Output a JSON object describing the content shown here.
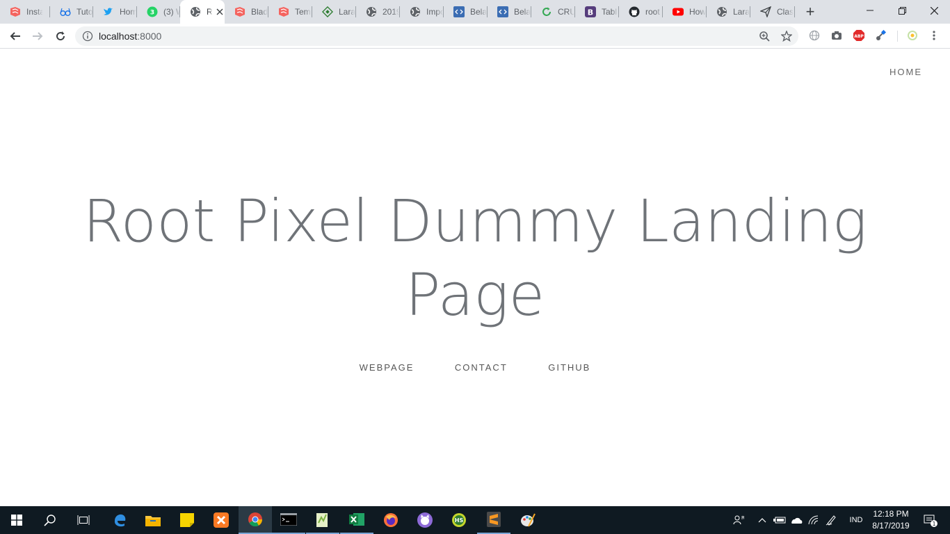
{
  "browser": {
    "tabs": [
      {
        "label": "Insta",
        "icon": "laravel-icon",
        "color": "#f4645f"
      },
      {
        "label": "Tuto",
        "icon": "glasses-icon",
        "color": "#1a73e8"
      },
      {
        "label": "Hom",
        "icon": "twitter-icon",
        "color": "#1da1f2"
      },
      {
        "label": "(3) W",
        "icon": "whatsapp-icon",
        "color": "#25d366"
      },
      {
        "label": "R",
        "icon": "globe-icon",
        "color": "#5f6368",
        "active": true
      },
      {
        "label": "Blad",
        "icon": "laravel-icon",
        "color": "#f4645f"
      },
      {
        "label": "Temp",
        "icon": "laravel-icon",
        "color": "#f4645f"
      },
      {
        "label": "Lara",
        "icon": "diamond-icon",
        "color": "#2e7d32"
      },
      {
        "label": "2019",
        "icon": "globe-icon",
        "color": "#5f6368"
      },
      {
        "label": "Impo",
        "icon": "globe-icon",
        "color": "#5f6368"
      },
      {
        "label": "Bela",
        "icon": "code-icon",
        "color": "#3b6db3"
      },
      {
        "label": "Bela",
        "icon": "code-icon",
        "color": "#3b6db3"
      },
      {
        "label": "CRU",
        "icon": "refresh-icon",
        "color": "#34a853"
      },
      {
        "label": "Tabl",
        "icon": "bootstrap-icon",
        "color": "#563d7c"
      },
      {
        "label": "root",
        "icon": "github-icon",
        "color": "#24292e"
      },
      {
        "label": "How",
        "icon": "youtube-icon",
        "color": "#ff0000"
      },
      {
        "label": "Lara",
        "icon": "globe-icon",
        "color": "#5f6368"
      },
      {
        "label": "Clas",
        "icon": "paper-plane-icon",
        "color": "#3c4043"
      }
    ],
    "new_tab": "+",
    "url_host": "localhost",
    "url_port": ":8000",
    "extensions": {
      "abp": "ABP"
    }
  },
  "page": {
    "nav_home": "HOME",
    "title_line1": "Root Pixel Dummy Landing",
    "title_line2": "Page",
    "links": [
      "WEBPAGE",
      "CONTACT",
      "GITHUB"
    ]
  },
  "taskbar": {
    "language": "IND",
    "time": "12:18 PM",
    "date": "8/17/2019",
    "notification_count": "1",
    "accent": "#0f1a22"
  }
}
